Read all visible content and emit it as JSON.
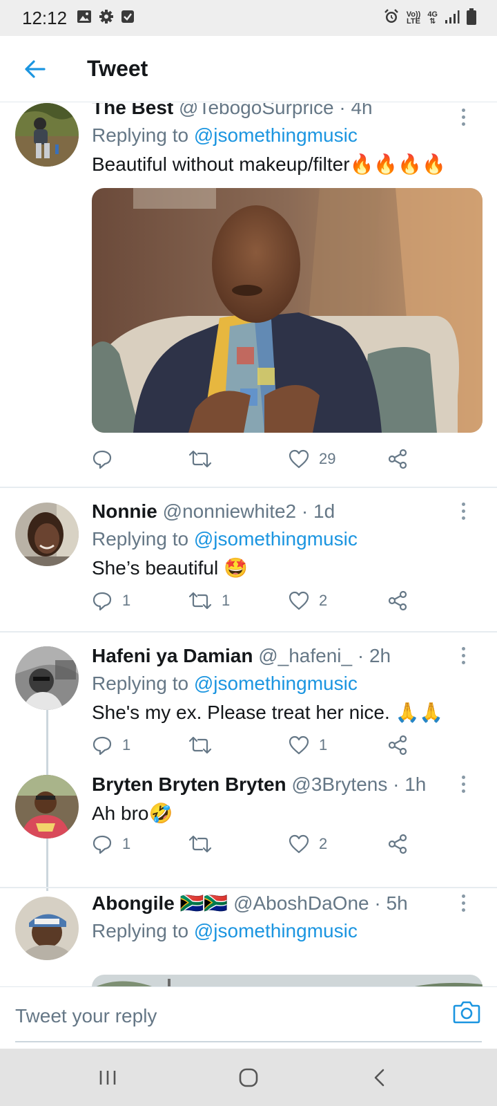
{
  "status_bar": {
    "time": "12:12",
    "left_icons": [
      "image-icon",
      "gear-icon",
      "check-box-icon"
    ],
    "right_icons": [
      "alarm-icon",
      "volte-icon",
      "4g-icon",
      "signal-icon",
      "battery-icon"
    ],
    "volte_top": "Vo))",
    "volte_bottom": "LTE",
    "network": "4G"
  },
  "header": {
    "title": "Tweet",
    "back_icon": "arrow-left-icon"
  },
  "colors": {
    "accent": "#1b95e0",
    "secondary_text": "#657786",
    "primary_text": "#14171a",
    "separator": "#e6ecf0"
  },
  "tweets": [
    {
      "name": "The Best",
      "handle": "@TebogoSurprice",
      "dot": "·",
      "time": "4h",
      "replying_prefix": "Replying to ",
      "replying_to": "@jsomethingmusic",
      "text": "Beautiful without makeup/filter🔥🔥🔥🔥",
      "has_media": true,
      "reply_count": "",
      "retweet_count": "",
      "like_count": "29"
    },
    {
      "name": "Nonnie",
      "handle": "@nonniewhite2",
      "dot": "·",
      "time": "1d",
      "replying_prefix": "Replying to ",
      "replying_to": "@jsomethingmusic",
      "text": "She’s beautiful 🤩",
      "reply_count": "1",
      "retweet_count": "1",
      "like_count": "2"
    },
    {
      "name": "Hafeni ya Damian",
      "handle": "@_hafeni_",
      "dot": "·",
      "time": "2h",
      "replying_prefix": "Replying to ",
      "replying_to": "@jsomethingmusic",
      "text": "She's my ex. Please treat her nice. 🙏🙏",
      "reply_count": "1",
      "retweet_count": "",
      "like_count": "1"
    },
    {
      "name": "Bryten Bryten Bryten",
      "handle": "@3Brytens",
      "dot": "·",
      "time": "1h",
      "text": "Ah bro🤣",
      "reply_count": "1",
      "retweet_count": "",
      "like_count": "2"
    },
    {
      "name": "Abongile 🇿🇦🇿🇦",
      "handle": "@AboshDaOne",
      "dot": "·",
      "time": "5h",
      "replying_prefix": "Replying to ",
      "replying_to": "@jsomethingmusic"
    }
  ],
  "composer": {
    "placeholder": "Tweet your reply",
    "camera_icon": "camera-icon"
  },
  "nav_bar": {
    "icons": [
      "recent-apps-icon",
      "home-icon",
      "back-icon"
    ]
  }
}
